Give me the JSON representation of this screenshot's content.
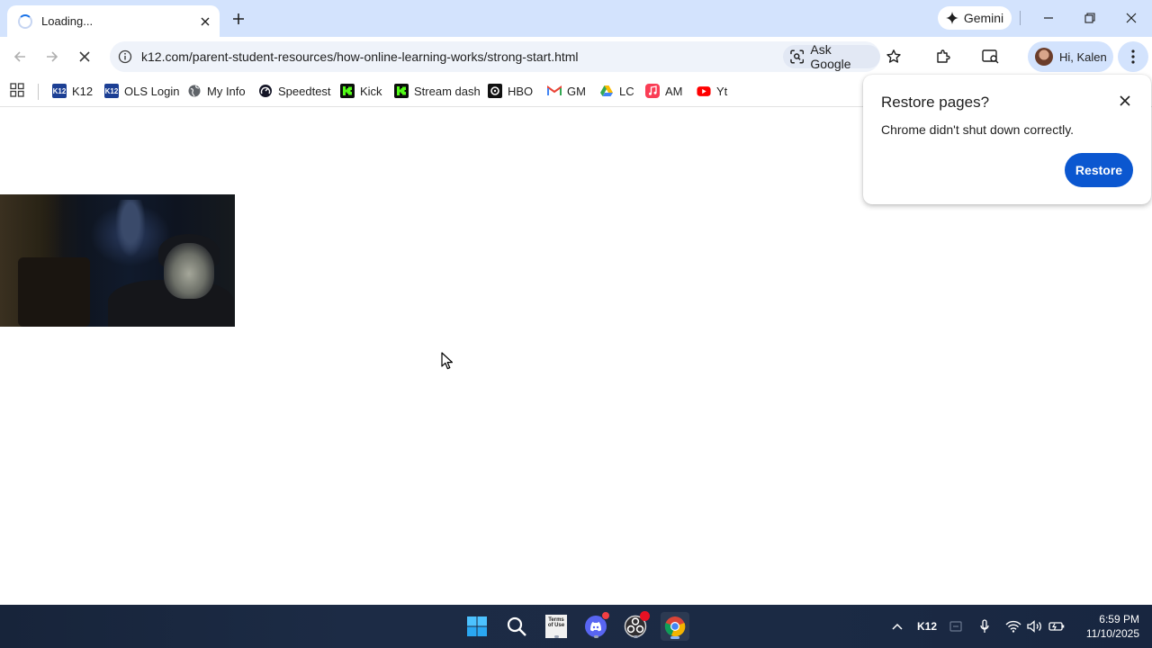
{
  "browser": {
    "tab": {
      "title": "Loading...",
      "state": "loading"
    },
    "gemini_label": "Gemini",
    "omnibox": {
      "url": "k12.com/parent-student-resources/how-online-learning-works/strong-start.html"
    },
    "ask_google_label": "Ask Google",
    "profile_label": "Hi, Kalen"
  },
  "bookmarks": [
    {
      "label": "K12",
      "icon": "k12-icon"
    },
    {
      "label": "OLS Login",
      "icon": "k12-icon"
    },
    {
      "label": "My Info",
      "icon": "globe-icon"
    },
    {
      "label": "Speedtest",
      "icon": "speedtest-icon"
    },
    {
      "label": "Kick",
      "icon": "kick-icon"
    },
    {
      "label": "Stream dash",
      "icon": "kick-icon"
    },
    {
      "label": "HBO",
      "icon": "hbo-icon"
    },
    {
      "label": "GM",
      "icon": "gmail-icon"
    },
    {
      "label": "LC",
      "icon": "drive-icon"
    },
    {
      "label": "AM",
      "icon": "apple-music-icon"
    },
    {
      "label": "Yt",
      "icon": "youtube-icon"
    }
  ],
  "restore_popup": {
    "title": "Restore pages?",
    "message": "Chrome didn't shut down correctly.",
    "button": "Restore"
  },
  "taskbar": {
    "pinned": [
      "start-icon",
      "search-icon",
      "terms-of-use-icon",
      "discord-icon",
      "obs-icon",
      "chrome-icon"
    ],
    "terms_label": "Terms of Use",
    "tray_k12": "K12",
    "clock_time": "6:59 PM",
    "clock_date": "11/10/2025"
  },
  "colors": {
    "chrome_frame": "#d3e3fd",
    "restore_button": "#0b57d0",
    "taskbar": "#1b2a44"
  }
}
